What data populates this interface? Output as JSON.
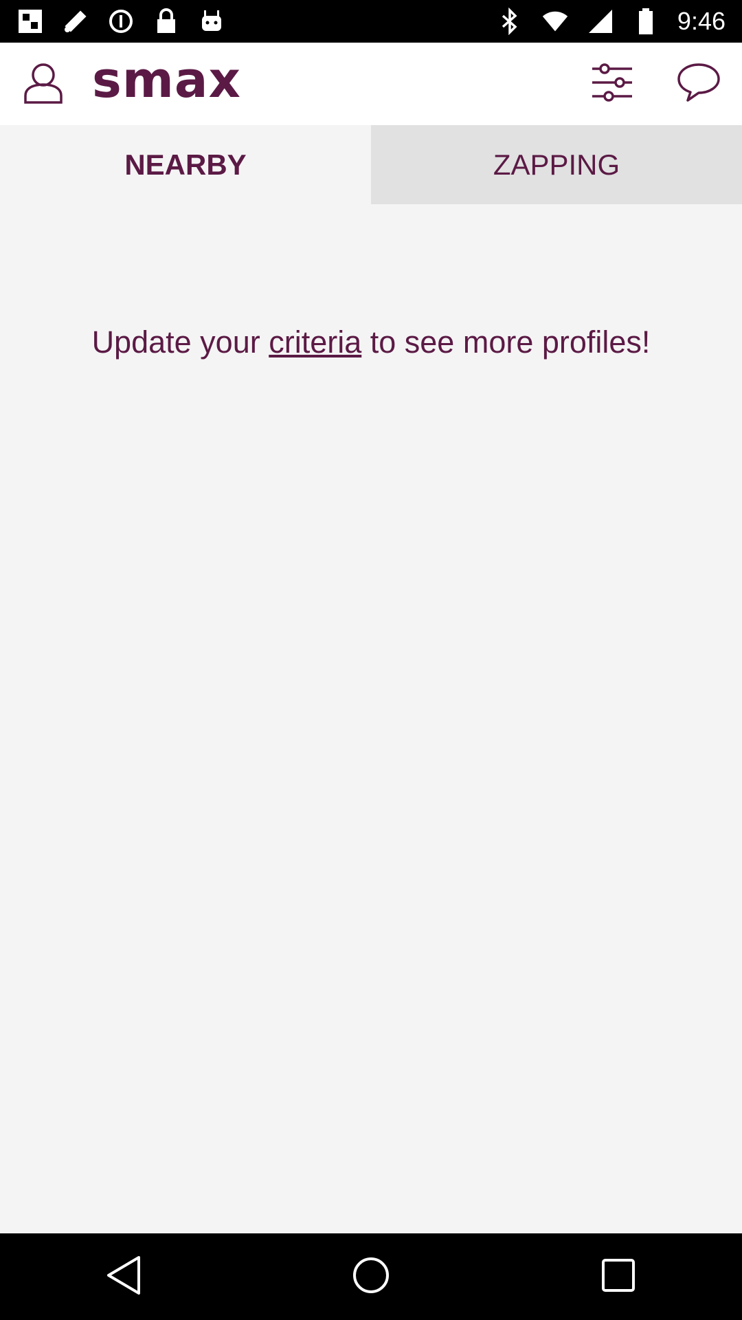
{
  "status_bar": {
    "time": "9:46",
    "left_icons": [
      "fake-gps-icon",
      "satellite-icon",
      "data-saver-icon",
      "lock-icon",
      "android-icon"
    ],
    "right_icons": [
      "bluetooth-icon",
      "wifi-icon",
      "cellular-signal-icon",
      "battery-icon"
    ]
  },
  "header": {
    "logo_text": "smax",
    "profile_icon": "profile-icon",
    "filter_icon": "filter-sliders-icon",
    "chat_icon": "chat-bubble-icon"
  },
  "tabs": [
    {
      "label": "NEARBY",
      "selected": true
    },
    {
      "label": "ZAPPING",
      "selected": false
    }
  ],
  "message": {
    "before": "Update your ",
    "link": "criteria",
    "after": " to see more profiles!"
  },
  "nav_bar": {
    "icons": [
      "back-icon",
      "home-icon",
      "recents-icon"
    ]
  },
  "colors": {
    "brand": "#5b1a45",
    "background": "#f4f4f4",
    "tab_inactive": "#e1e1e1"
  }
}
